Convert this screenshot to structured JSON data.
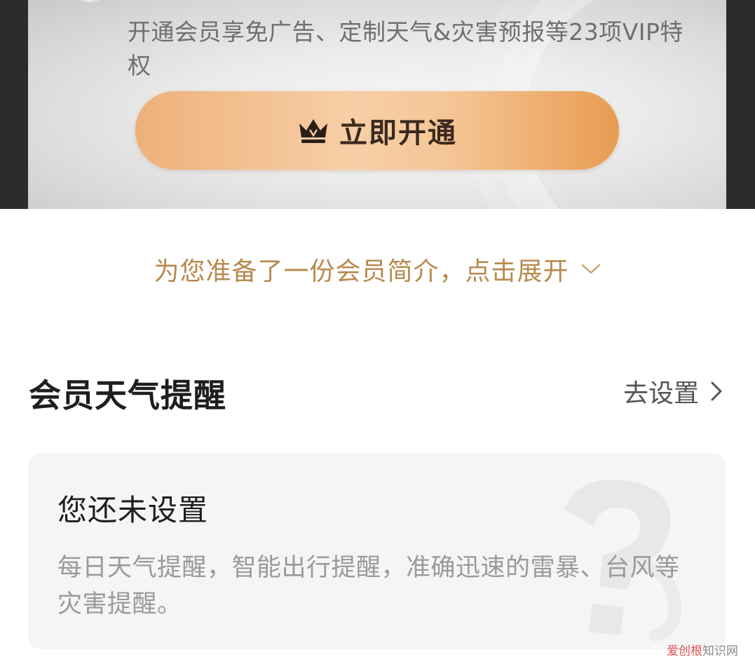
{
  "vip": {
    "description": "开通会员享免广告、定制天气&灾害预报等23项VIP特权",
    "button_label": "立即开通",
    "button_icon": "crown-icon"
  },
  "intro": {
    "text": "为您准备了一份会员简介，点击展开",
    "icon": "chevron-down-icon"
  },
  "reminder_section": {
    "title": "会员天气提醒",
    "settings_label": "去设置",
    "settings_icon": "chevron-right-icon",
    "card": {
      "title": "您还未设置",
      "description": "每日天气提醒，智能出行提醒，准确迅速的雷暴、台风等灾害提醒。",
      "background_icon": "question-mark-icon"
    }
  },
  "watermark": {
    "brand": "爱创根",
    "suffix": "知识网"
  },
  "colors": {
    "accent_gold": "#b78a4e",
    "button_orange": "#eeb07a",
    "frame_dark": "#2e2b2b"
  }
}
